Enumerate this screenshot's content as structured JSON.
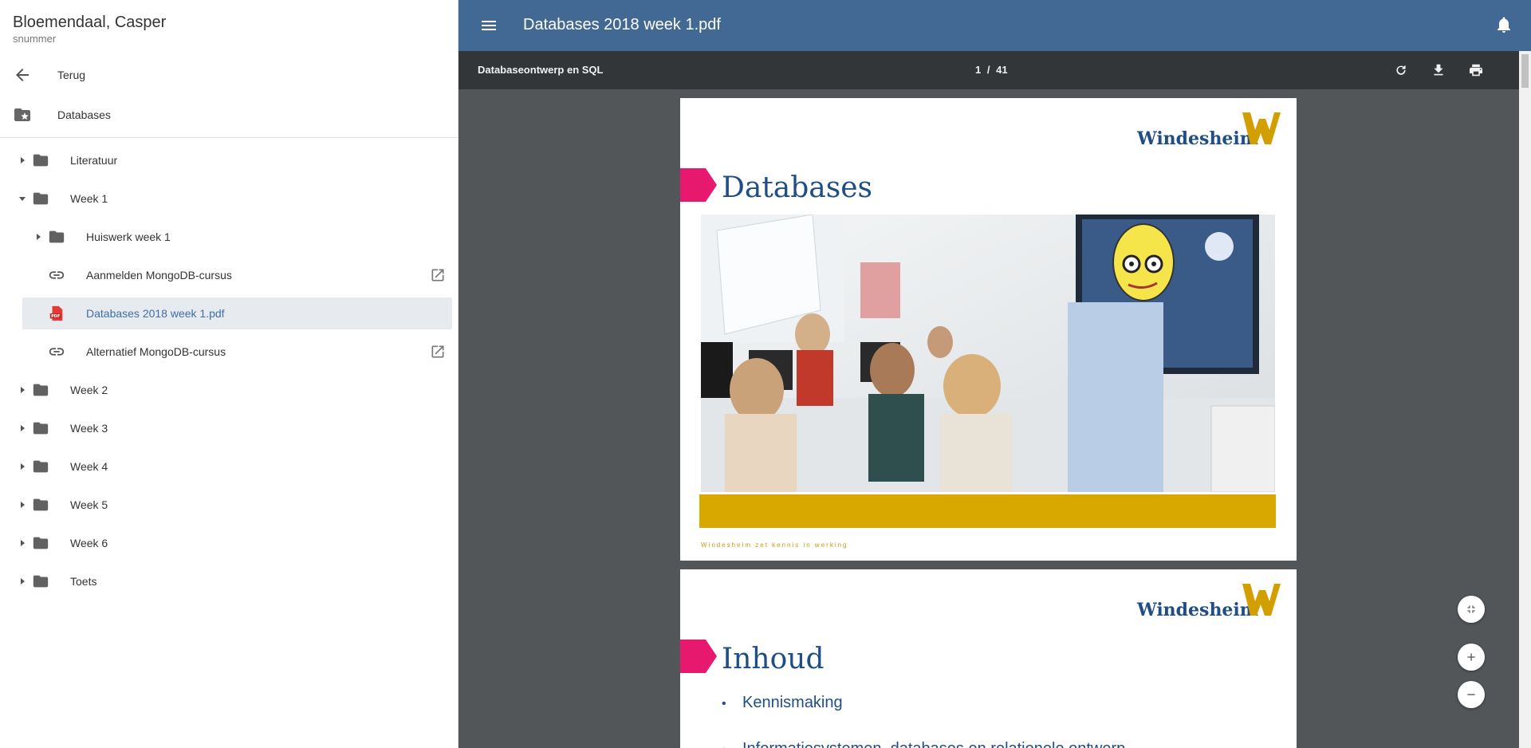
{
  "user": {
    "name": "Bloemendaal, Casper",
    "sub": "snummer"
  },
  "nav": {
    "back_label": "Terug",
    "course_label": "Databases"
  },
  "tree": [
    {
      "label": "Literatuur",
      "type": "folder",
      "expanded": false
    },
    {
      "label": "Week 1",
      "type": "folder",
      "expanded": true
    },
    {
      "label": "Huiswerk week 1",
      "type": "folder",
      "expanded": false
    },
    {
      "label": "Aanmelden MongoDB-cursus",
      "type": "link"
    },
    {
      "label": "Databases 2018 week 1.pdf",
      "type": "pdf",
      "selected": true
    },
    {
      "label": "Alternatief MongoDB-cursus",
      "type": "link"
    },
    {
      "label": "Week 2",
      "type": "folder",
      "expanded": false
    },
    {
      "label": "Week 3",
      "type": "folder",
      "expanded": false
    },
    {
      "label": "Week 4",
      "type": "folder",
      "expanded": false
    },
    {
      "label": "Week 5",
      "type": "folder",
      "expanded": false
    },
    {
      "label": "Week 6",
      "type": "folder",
      "expanded": false
    },
    {
      "label": "Toets",
      "type": "folder",
      "expanded": false
    }
  ],
  "topbar": {
    "title": "Databases 2018 week 1.pdf"
  },
  "viewer": {
    "doc_title": "Databaseontwerp en SQL",
    "page_current": "1",
    "page_sep": "/",
    "page_total": "41"
  },
  "slides": {
    "logo_text": "Windesheim",
    "slide1_title": "Databases",
    "slide1_tagline": "Windesheim zet kennis in werking",
    "slide2_title": "Inhoud",
    "slide2_bullet1": "Kennismaking",
    "slide2_bullet2": "Informatiesystemen, databases en relationele ontwerp..."
  },
  "colors": {
    "topbar": "#426894",
    "viewer_bg": "#525659",
    "toolbar": "#323639",
    "accent_pink": "#e6196e",
    "accent_gold": "#d8a800",
    "brand_blue": "#1f4e87"
  },
  "icons": {
    "back": "arrow-left-icon",
    "course": "folder-star-icon",
    "menu": "hamburger-icon",
    "bell": "bell-icon",
    "rotate": "rotate-icon",
    "download": "download-icon",
    "print": "print-icon",
    "fit": "fit-page-icon",
    "zoom_in": "plus-icon",
    "zoom_out": "minus-icon"
  }
}
